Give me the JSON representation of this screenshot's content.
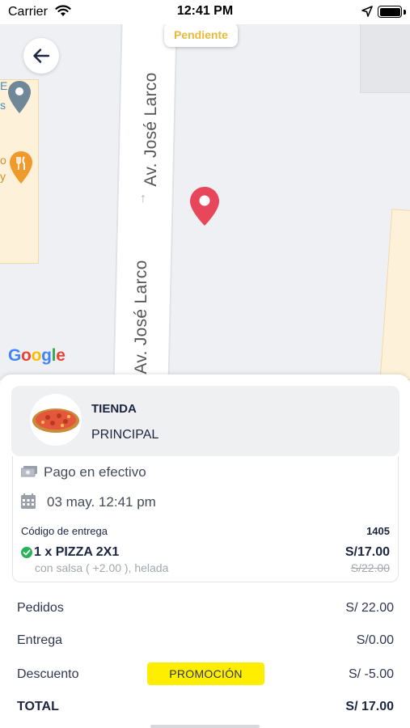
{
  "status_bar": {
    "carrier": "Carrier",
    "time": "12:41 PM"
  },
  "map": {
    "status_badge": "Pendiente",
    "street_name_top": "Av. José Larco",
    "street_name_bottom": "Av. José Larco",
    "partial_labels": [
      "E",
      "s",
      "o",
      "y"
    ],
    "google_logo": "Google",
    "colors": {
      "pin_red": "#e8465b",
      "badge_text": "#e8b93a",
      "poi_block": "#fdf2d9"
    }
  },
  "store": {
    "name": "TIENDA",
    "subtitle": "PRINCIPAL"
  },
  "order": {
    "payment_method": "Pago en efectivo",
    "date": "03 may. 12:41 pm",
    "delivery_code_label": "Código de entrega",
    "delivery_code": "1405",
    "item": {
      "name": "1 x PIZZA 2X1",
      "price": "S/17.00",
      "description": "con salsa ( +2.00 ), helada",
      "original_price": "S/22.00"
    }
  },
  "summary": {
    "orders_label": "Pedidos",
    "orders_value": "S/ 22.00",
    "delivery_label": "Entrega",
    "delivery_value": "S/0.00",
    "discount_label": "Descuento",
    "promo_badge": "PROMOCIÓN",
    "discount_value": "S/ -5.00",
    "total_label": "TOTAL",
    "total_value": "S/ 17.00"
  },
  "icons": {
    "back": "arrow-left-icon",
    "payment": "cash-icon",
    "date": "calendar-icon",
    "item_status": "check-circle-icon"
  },
  "theme": {
    "primary_text": "#1c2541",
    "promo_yellow": "#ffee00"
  }
}
